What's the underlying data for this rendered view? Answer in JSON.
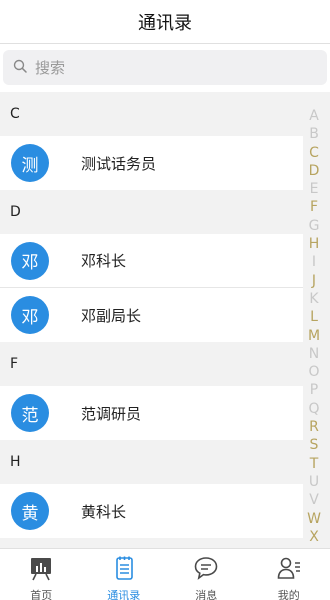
{
  "header": {
    "title": "通讯录"
  },
  "search": {
    "placeholder": "搜索"
  },
  "sections": [
    {
      "letter": "C",
      "contacts": [
        {
          "avatar": "测",
          "name": "测试话务员"
        }
      ]
    },
    {
      "letter": "D",
      "contacts": [
        {
          "avatar": "邓",
          "name": "邓科长"
        },
        {
          "avatar": "邓",
          "name": "邓副局长"
        }
      ]
    },
    {
      "letter": "F",
      "contacts": [
        {
          "avatar": "范",
          "name": "范调研员"
        }
      ]
    },
    {
      "letter": "H",
      "contacts": [
        {
          "avatar": "黄",
          "name": "黄科长"
        }
      ]
    }
  ],
  "index_bar": {
    "letters": [
      "A",
      "B",
      "C",
      "D",
      "E",
      "F",
      "G",
      "H",
      "I",
      "J",
      "K",
      "L",
      "M",
      "N",
      "O",
      "P",
      "Q",
      "R",
      "S",
      "T",
      "U",
      "V",
      "W",
      "X"
    ],
    "active_letters": [
      "C",
      "D",
      "F",
      "H",
      "J",
      "L",
      "M",
      "R",
      "S",
      "T",
      "W",
      "X"
    ],
    "active_color": "#b7a460",
    "inactive_color": "#c8c8c8"
  },
  "tabs": [
    {
      "label": "首页",
      "icon": "home-board-icon"
    },
    {
      "label": "通讯录",
      "icon": "contacts-icon",
      "active": true
    },
    {
      "label": "消息",
      "icon": "chat-bubble-icon"
    },
    {
      "label": "我的",
      "icon": "profile-icon"
    }
  ],
  "colors": {
    "accent": "#2a8de1",
    "avatar_bg": "#2a8de1"
  }
}
